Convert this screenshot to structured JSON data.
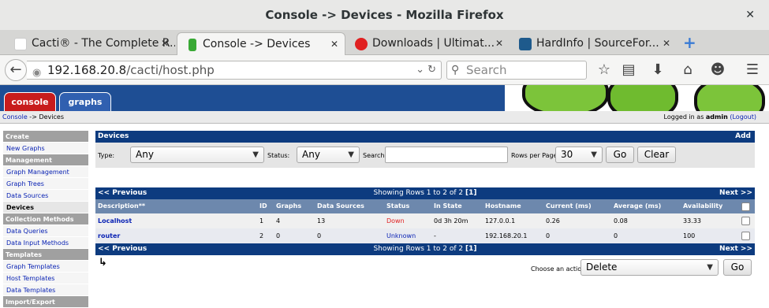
{
  "window": {
    "title": "Console -> Devices - Mozilla Firefox"
  },
  "tabs": [
    {
      "label": "Cacti® - The Complete R...",
      "icon_color": "#ffffff"
    },
    {
      "label": "Console -> Devices",
      "icon_color": "#39a935"
    },
    {
      "label": "Downloads | Ultimat...",
      "icon_color": "#e02020"
    },
    {
      "label": "HardInfo | SourceFor...",
      "icon_color": "#1e5a8c"
    }
  ],
  "url": {
    "host": "192.168.20.8",
    "path": "/cacti/host.php"
  },
  "search_placeholder": "Search",
  "banner_tabs": {
    "console": "console",
    "graphs": "graphs"
  },
  "breadcrumb": {
    "root": "Console",
    "sep": " -> ",
    "current": "Devices"
  },
  "login": {
    "prefix": "Logged in as ",
    "user": "admin",
    "logout": "(Logout)"
  },
  "sidebar": [
    {
      "type": "header",
      "label": "Create"
    },
    {
      "type": "item",
      "label": "New Graphs"
    },
    {
      "type": "header",
      "label": "Management"
    },
    {
      "type": "item",
      "label": "Graph Management"
    },
    {
      "type": "item",
      "label": "Graph Trees"
    },
    {
      "type": "item",
      "label": "Data Sources"
    },
    {
      "type": "item",
      "label": "Devices",
      "selected": true
    },
    {
      "type": "header",
      "label": "Collection Methods"
    },
    {
      "type": "item",
      "label": "Data Queries"
    },
    {
      "type": "item",
      "label": "Data Input Methods"
    },
    {
      "type": "header",
      "label": "Templates"
    },
    {
      "type": "item",
      "label": "Graph Templates"
    },
    {
      "type": "item",
      "label": "Host Templates"
    },
    {
      "type": "item",
      "label": "Data Templates"
    },
    {
      "type": "header",
      "label": "Import/Export"
    }
  ],
  "devices": {
    "title": "Devices",
    "add": "Add",
    "filter": {
      "type_label": "Type:",
      "type_value": "Any",
      "status_label": "Status:",
      "status_value": "Any",
      "search_label": "Search:",
      "search_value": "",
      "rows_label": "Rows per Page:",
      "rows_value": "30",
      "go": "Go",
      "clear": "Clear"
    },
    "nav": {
      "prev": "<< Previous",
      "showing": "Showing Rows 1 to 2 of 2",
      "page": "[1]",
      "next": "Next >>"
    },
    "columns": [
      "Description**",
      "ID",
      "Graphs",
      "Data Sources",
      "Status",
      "In State",
      "Hostname",
      "Current (ms)",
      "Average (ms)",
      "Availability"
    ],
    "rows": [
      {
        "description": "Localhost",
        "id": "1",
        "graphs": "4",
        "data_sources": "13",
        "status": "Down",
        "status_color": "#e02020",
        "in_state": "0d 3h 20m",
        "hostname": "127.0.0.1",
        "current": "0.26",
        "average": "0.08",
        "availability": "33.33"
      },
      {
        "description": "router",
        "id": "2",
        "graphs": "0",
        "data_sources": "0",
        "status": "Unknown",
        "status_color": "#0a23b4",
        "in_state": "-",
        "hostname": "192.168.20.1",
        "current": "0",
        "average": "0",
        "availability": "100"
      }
    ],
    "action": {
      "label": "Choose an action:",
      "value": "Delete",
      "go": "Go"
    }
  }
}
